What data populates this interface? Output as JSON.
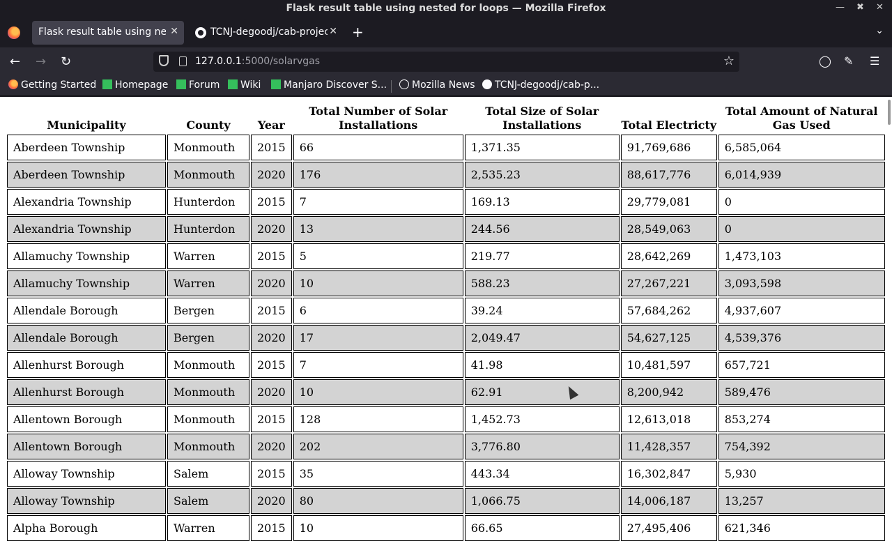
{
  "window": {
    "title": "Flask result table using nested for loops — Mozilla Firefox"
  },
  "tabs": [
    {
      "label": "Flask result table using nested for loops",
      "active": true
    },
    {
      "label": "TCNJ-degoodj/cab-project",
      "active": false
    }
  ],
  "url": {
    "host": "127.0.0.1",
    "path": ":5000/solarvgas"
  },
  "bookmarks": [
    {
      "label": "Getting Started",
      "icon": "firefox-icon"
    },
    {
      "label": "Homepage",
      "icon": "manjaro-icon"
    },
    {
      "label": "Forum",
      "icon": "manjaro-icon"
    },
    {
      "label": "Wiki",
      "icon": "manjaro-icon"
    },
    {
      "label": "Manjaro Discover S...",
      "icon": "manjaro-icon"
    },
    {
      "label": "Mozilla News",
      "icon": "globe-icon"
    },
    {
      "label": "TCNJ-degoodj/cab-p...",
      "icon": "github-icon"
    }
  ],
  "table": {
    "headers": [
      "Municipality",
      "County",
      "Year",
      "Total Number of Solar Installations",
      "Total Size of Solar Installations",
      "Total Electricty",
      "Total Amount of Natural Gas Used"
    ],
    "rows": [
      [
        "Aberdeen Township",
        "Monmouth",
        "2015",
        "66",
        "1,371.35",
        "91,769,686",
        "6,585,064"
      ],
      [
        "Aberdeen Township",
        "Monmouth",
        "2020",
        "176",
        "2,535.23",
        "88,617,776",
        "6,014,939"
      ],
      [
        "Alexandria Township",
        "Hunterdon",
        "2015",
        "7",
        "169.13",
        "29,779,081",
        "0"
      ],
      [
        "Alexandria Township",
        "Hunterdon",
        "2020",
        "13",
        "244.56",
        "28,549,063",
        "0"
      ],
      [
        "Allamuchy Township",
        "Warren",
        "2015",
        "5",
        "219.77",
        "28,642,269",
        "1,473,103"
      ],
      [
        "Allamuchy Township",
        "Warren",
        "2020",
        "10",
        "588.23",
        "27,267,221",
        "3,093,598"
      ],
      [
        "Allendale Borough",
        "Bergen",
        "2015",
        "6",
        "39.24",
        "57,684,262",
        "4,937,607"
      ],
      [
        "Allendale Borough",
        "Bergen",
        "2020",
        "17",
        "2,049.47",
        "54,627,125",
        "4,539,376"
      ],
      [
        "Allenhurst Borough",
        "Monmouth",
        "2015",
        "7",
        "41.98",
        "10,481,597",
        "657,721"
      ],
      [
        "Allenhurst Borough",
        "Monmouth",
        "2020",
        "10",
        "62.91",
        "8,200,942",
        "589,476"
      ],
      [
        "Allentown Borough",
        "Monmouth",
        "2015",
        "128",
        "1,452.73",
        "12,613,018",
        "853,274"
      ],
      [
        "Allentown Borough",
        "Monmouth",
        "2020",
        "202",
        "3,776.80",
        "11,428,357",
        "754,392"
      ],
      [
        "Alloway Township",
        "Salem",
        "2015",
        "35",
        "443.34",
        "16,302,847",
        "5,930"
      ],
      [
        "Alloway Township",
        "Salem",
        "2020",
        "80",
        "1,066.75",
        "14,006,187",
        "13,257"
      ],
      [
        "Alpha Borough",
        "Warren",
        "2015",
        "10",
        "66.65",
        "27,495,406",
        "621,346"
      ]
    ]
  },
  "colors": {
    "alt_row": "#d3d3d3",
    "chrome_dark": "#1c1b22",
    "chrome": "#2b2a33"
  }
}
